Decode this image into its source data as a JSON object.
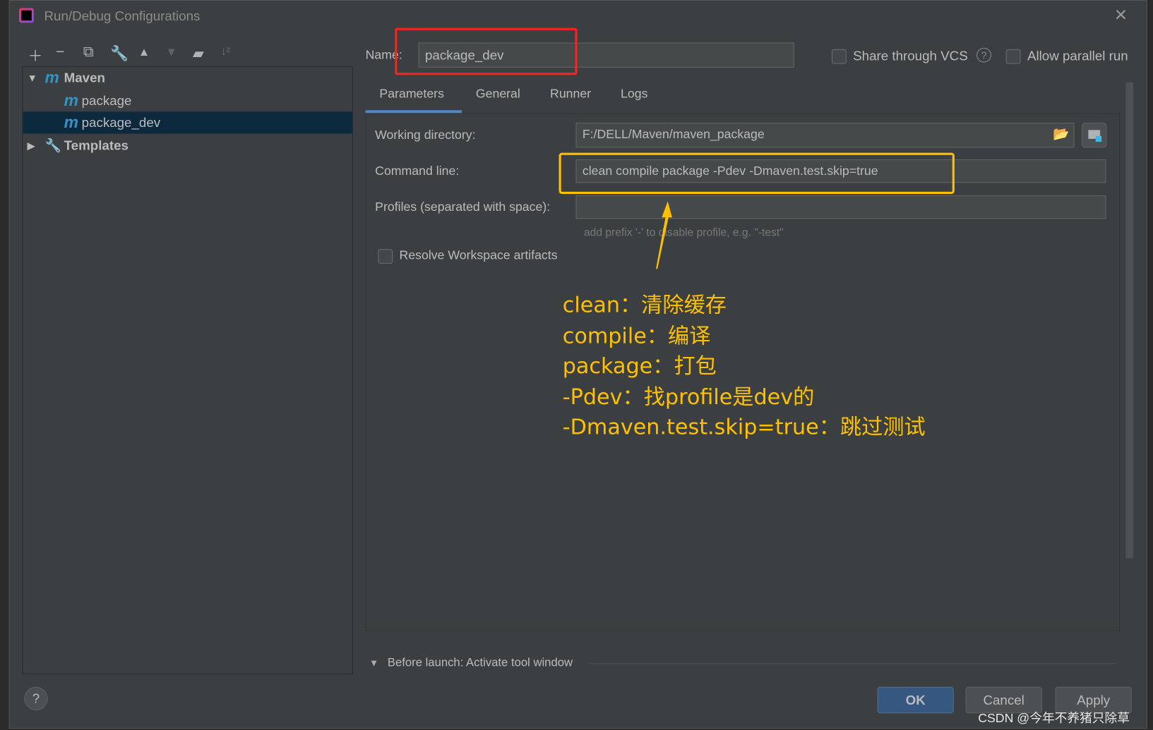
{
  "dialog": {
    "title": "Run/Debug Configurations",
    "close_icon": "close-icon"
  },
  "toolbar": [
    "add-icon",
    "remove-icon",
    "copy-icon",
    "wrench-icon",
    "move-up-icon",
    "move-down-icon",
    "new-folder-icon",
    "sort-icon"
  ],
  "tree": {
    "items": [
      {
        "label": "Maven",
        "level": 0,
        "expanded": true,
        "icon": "maven-icon"
      },
      {
        "label": "package",
        "level": 1,
        "icon": "maven-icon"
      },
      {
        "label": "package_dev",
        "level": 1,
        "icon": "maven-icon",
        "selected": true
      },
      {
        "label": "Templates",
        "level": 0,
        "expanded": false,
        "icon": "wrench-icon"
      }
    ]
  },
  "name": {
    "label": "Name:",
    "value": "package_dev"
  },
  "share_vcs": {
    "label": "Share through VCS",
    "checked": false
  },
  "allow_parallel": {
    "label": "Allow parallel run",
    "checked": false
  },
  "tabs": [
    {
      "label": "Parameters",
      "active": true
    },
    {
      "label": "General"
    },
    {
      "label": "Runner"
    },
    {
      "label": "Logs"
    }
  ],
  "params": {
    "working_dir": {
      "label": "Working directory:",
      "value": "F:/DELL/Maven/maven_package"
    },
    "command_line": {
      "label": "Command line:",
      "value": "clean compile package -Pdev -Dmaven.test.skip=true"
    },
    "profiles": {
      "label": "Profiles (separated with space):",
      "value": "",
      "hint": "add prefix '-' to disable profile, e.g. \"-test\""
    },
    "resolve": {
      "label": "Resolve Workspace artifacts",
      "checked": false
    }
  },
  "annotation": {
    "lines": [
      "clean：清除缓存",
      "compile：编译",
      "package：打包",
      "-Pdev：找profile是dev的",
      "-Dmaven.test.skip=true：跳过测试"
    ],
    "color": "#ffc000",
    "highlight_name_color": "#ff2020"
  },
  "before_launch": "Before launch: Activate tool window",
  "buttons": {
    "ok": "OK",
    "cancel": "Cancel",
    "apply": "Apply",
    "help": "?"
  },
  "watermark": "CSDN @今年不养猪只除草"
}
